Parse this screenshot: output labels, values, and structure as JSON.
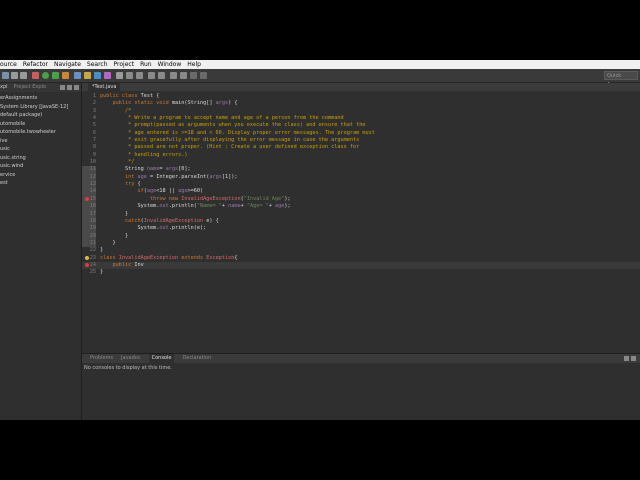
{
  "menubar": [
    "ource",
    "Refactor",
    "Navigate",
    "Search",
    "Project",
    "Run",
    "Window",
    "Help"
  ],
  "quick_access": "Quick Access",
  "left_panel": {
    "tabs": [
      "xpl",
      "Project Explo"
    ],
    "tree": [
      "erAssignments",
      "System Library [JavaSE-12]",
      "",
      "default package)",
      "utomobile",
      "utomobile.twowheeler",
      "ive",
      "usic",
      "usic.string",
      "usic.wind",
      "ervice",
      "est"
    ]
  },
  "editor": {
    "tab_label": "*Test.java",
    "lines": [
      {
        "n": "1",
        "t": "public class Test {"
      },
      {
        "n": "2",
        "t": "    public static void main(String[] args) {"
      },
      {
        "n": "3",
        "t": "        /*"
      },
      {
        "n": "4",
        "t": "         * Write a program to accept name and age of a person from the command"
      },
      {
        "n": "5",
        "t": "         * prompt(passed as arguments when you execute the class) and ensure that the"
      },
      {
        "n": "6",
        "t": "         * age entered is >=18 and < 60. Display proper error messages. The program must"
      },
      {
        "n": "7",
        "t": "         * exit gracefully after displaying the error message in case the arguments"
      },
      {
        "n": "8",
        "t": "         * passed are not proper. (Hint : Create a user defined exception class for"
      },
      {
        "n": "9",
        "t": "         * handling errors.)"
      },
      {
        "n": "10",
        "t": "         */"
      },
      {
        "n": "11",
        "t": "        String name= args[0];"
      },
      {
        "n": "12",
        "t": "        int age = Integer.parseInt(args[1]);"
      },
      {
        "n": "13",
        "t": "        try {"
      },
      {
        "n": "14",
        "t": "            if(age<18 || age>=60)"
      },
      {
        "n": "15",
        "t": "                throw new InvalidAgeException(\"Invalid Age\");"
      },
      {
        "n": "16",
        "t": "            System.out.println(\"Name= \"+ name+ \"Age= \"+ age);"
      },
      {
        "n": "17",
        "t": "        }"
      },
      {
        "n": "18",
        "t": "        catch(InvalidAgeException e) {"
      },
      {
        "n": "19",
        "t": "            System.out.println(e);"
      },
      {
        "n": "20",
        "t": "        }"
      },
      {
        "n": "21",
        "t": "    }"
      },
      {
        "n": "22",
        "t": "}"
      },
      {
        "n": "23",
        "t": "class InvalidAgeException extends Exception{"
      },
      {
        "n": "24",
        "t": "    public Inv"
      },
      {
        "n": "25",
        "t": "}"
      }
    ]
  },
  "bottom_panel": {
    "tabs": [
      "Problems",
      "Javadoc",
      "Console",
      "Declaration"
    ],
    "active_tab": "Console",
    "message": "No consoles to display at this time."
  },
  "colors": {
    "error_marker": "#e03b3b",
    "warning_marker": "#d9b84a"
  }
}
